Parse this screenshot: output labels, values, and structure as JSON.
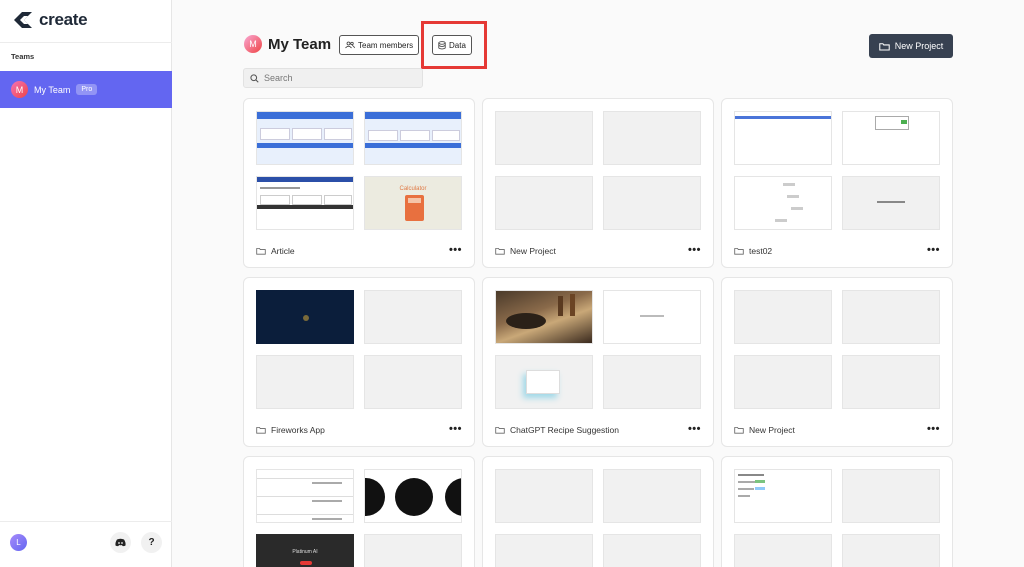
{
  "app": {
    "logo_text": "create"
  },
  "sidebar": {
    "section_title": "Teams",
    "team": {
      "avatar_letter": "M",
      "name": "My Team",
      "badge": "Pro"
    },
    "user_avatar_letter": "L",
    "help_label": "?"
  },
  "header": {
    "avatar_letter": "M",
    "title": "My Team",
    "team_members_label": "Team members",
    "data_label": "Data",
    "new_project_label": "New Project",
    "search_placeholder": "Search"
  },
  "thumb_text": {
    "calculator": "Calculator",
    "platinum": "Platinum AI"
  },
  "projects": [
    {
      "name": "Article"
    },
    {
      "name": "New Project"
    },
    {
      "name": "test02"
    },
    {
      "name": "Fireworks App"
    },
    {
      "name": "ChatGPT Recipe Suggestion"
    },
    {
      "name": "New Project"
    },
    {
      "name": ""
    },
    {
      "name": ""
    },
    {
      "name": ""
    }
  ],
  "colors": {
    "accent": "#6366f1",
    "primary_button": "#374151",
    "highlight": "#e53935"
  }
}
